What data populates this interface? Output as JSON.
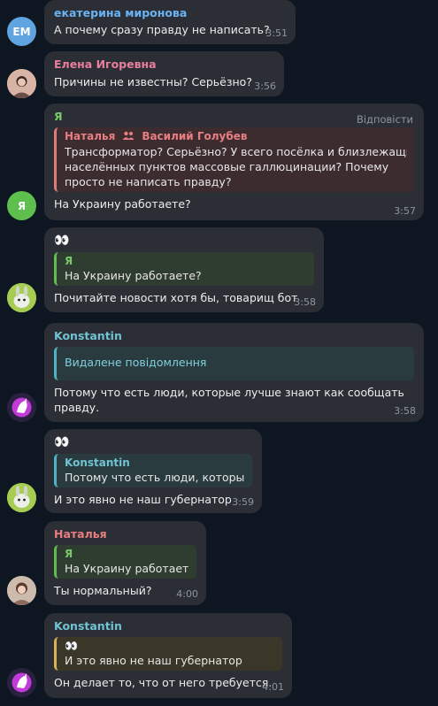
{
  "messages": [
    {
      "sender": "екатерина миронова",
      "avatar_initials": "ЕМ",
      "text": "А почему сразу правду не написать?",
      "time": "3:51"
    },
    {
      "sender": "Елена Игоревна",
      "text": "Причины не известны?  Серьёзно?",
      "time": "3:56"
    },
    {
      "sender": "Я",
      "avatar_initials": "Я",
      "action": "Відповісти",
      "reply": {
        "name1": "Наталья",
        "name2": "Василий Голубев",
        "lines": [
          "Трансформатор? Серьёзно? У всего посёлка и близлежащих",
          "населённых пунктов массовые галлюцинации? Почему",
          "просто не написать правду?"
        ]
      },
      "text": "На Украину работаете?",
      "time": "3:57"
    },
    {
      "sender": "👀",
      "reply": {
        "name": "Я",
        "text": "На Украину работаете?"
      },
      "text": "Почитайте новости хотя бы, товарищ бот",
      "time": "3:58"
    },
    {
      "sender": "Konstantin",
      "reply": {
        "text": "Видалене повідомлення"
      },
      "lines": [
        "Потому что есть люди, которые лучше знают как сообщать",
        "правду."
      ],
      "time": "3:58"
    },
    {
      "sender": "👀",
      "reply": {
        "name": "Konstantin",
        "text": "Потому что есть люди, которы..."
      },
      "text": "И это явно не наш губернатор",
      "time": "3:59"
    },
    {
      "sender": "Наталья",
      "reply": {
        "name": "Я",
        "text": "На Украину работает..."
      },
      "text": "Ты нормальный?",
      "time": "4:00"
    },
    {
      "sender": "Konstantin",
      "reply": {
        "name": "👀",
        "text": "И это явно не наш губернатор"
      },
      "text": "Он делает то, что от него требуется.",
      "time": "4:01"
    }
  ],
  "colors": {
    "background": "#0e1621",
    "bubble": "#2b2f35",
    "time": "#8c96a0"
  }
}
